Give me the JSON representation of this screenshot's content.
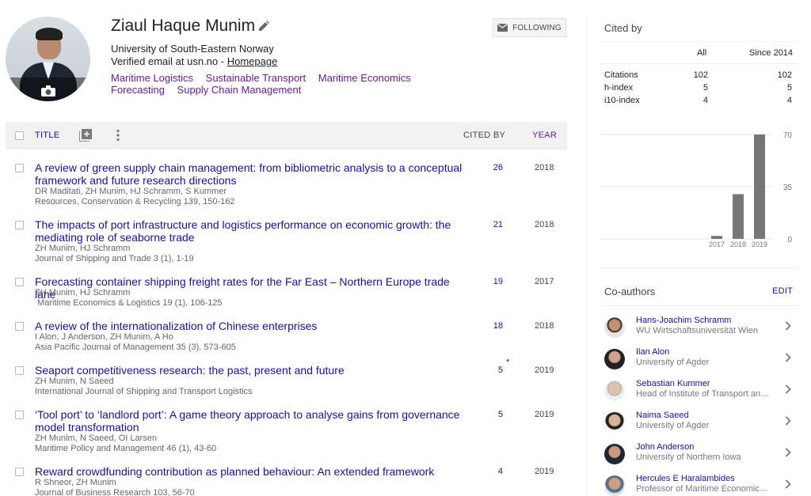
{
  "profile": {
    "name": "Ziaul Haque Munim",
    "affiliation": "University of South-Eastern Norway",
    "email_prefix": "Verified email at usn.no - ",
    "homepage": "Homepage",
    "interests": [
      "Maritime Logistics",
      "Sustainable Transport",
      "Maritime Economics",
      "Forecasting",
      "Supply Chain Management"
    ],
    "follow_label": "FOLLOWING"
  },
  "table": {
    "title_header": "TITLE",
    "cited_header": "CITED BY",
    "year_header": "YEAR",
    "rows": [
      {
        "title": "A review of green supply chain management: from bibliometric analysis to a conceptual framework and future research directions",
        "authors": "DR Maditati, ZH Munim, HJ Schramm, S Kummer",
        "journal": "Resources, Conservation & Recycling 139, 150-162",
        "cited": "26",
        "year": "2018"
      },
      {
        "title": "The impacts of port infrastructure and logistics performance on economic growth: the mediating role of seaborne trade",
        "authors": "ZH Munim, HJ Schramm",
        "journal": "Journal of Shipping and Trade 3 (1), 1-19",
        "cited": "21",
        "year": "2018"
      },
      {
        "title": "Forecasting container shipping freight rates for the Far East – Northern Europe trade lane",
        "authors": "ZH Munim, HJ Schramm",
        "journal": " Maritime Economics & Logistics 19 (1), 106-125",
        "cited": "19",
        "year": "2017"
      },
      {
        "title": "A review of the internationalization of Chinese enterprises",
        "authors": "I Alon, J Anderson, ZH Munim, A Ho",
        "journal": "Asia Pacific Journal of Management 35 (3), 573-605",
        "cited": "18",
        "year": "2018"
      },
      {
        "title": "Seaport competitiveness research: the past, present and future",
        "authors": "ZH Munim, N Saeed",
        "journal": "International Journal of Shipping and Transport Logistics",
        "cited": "5",
        "star": "*",
        "year": "2019"
      },
      {
        "title": "‘Tool port’ to ‘landlord port’: A game theory approach to analyse gains from governance model transformation",
        "authors": "ZH Munim, N Saeed, OI Larsen",
        "journal": "Maritime Policy and Management 46 (1), 43-60",
        "cited": "5",
        "year": "2019"
      },
      {
        "title": "Reward crowdfunding contribution as planned behaviour: An extended framework",
        "authors": "R Shneor, ZH Munim",
        "journal": "Journal of Business Research 103, 56-70",
        "cited": "4",
        "year": "2019"
      }
    ]
  },
  "cited_by": {
    "title": "Cited by",
    "col_all": "All",
    "col_since": "Since 2014",
    "stats": [
      {
        "label": "Citations",
        "all": "102",
        "since": "102"
      },
      {
        "label": "h-index",
        "all": "5",
        "since": "5"
      },
      {
        "label": "i10-index",
        "all": "4",
        "since": "4"
      }
    ]
  },
  "chart_data": {
    "type": "bar",
    "categories": [
      "2017",
      "2018",
      "2019"
    ],
    "values": [
      2,
      30,
      70
    ],
    "yticks": [
      "70",
      "35",
      "0"
    ],
    "ylim": [
      0,
      70
    ],
    "bar_color": "#777777"
  },
  "coauthors": {
    "title": "Co-authors",
    "edit_label": "EDIT",
    "items": [
      {
        "name": "Hans-Joachim Schramm",
        "affiliation": "WU Wirtschaftsuniversität Wien"
      },
      {
        "name": "Ilan Alon",
        "affiliation": "University of Agder"
      },
      {
        "name": "Sebastian Kummer",
        "affiliation": "Head of Institute of Transport and Logistics Management"
      },
      {
        "name": "Naima Saeed",
        "affiliation": "University of Agder"
      },
      {
        "name": "John Anderson",
        "affiliation": "University of Northern Iowa"
      },
      {
        "name": "Hercules E Haralambides",
        "affiliation": "Professor of Maritime Economics and Logistics"
      }
    ]
  }
}
